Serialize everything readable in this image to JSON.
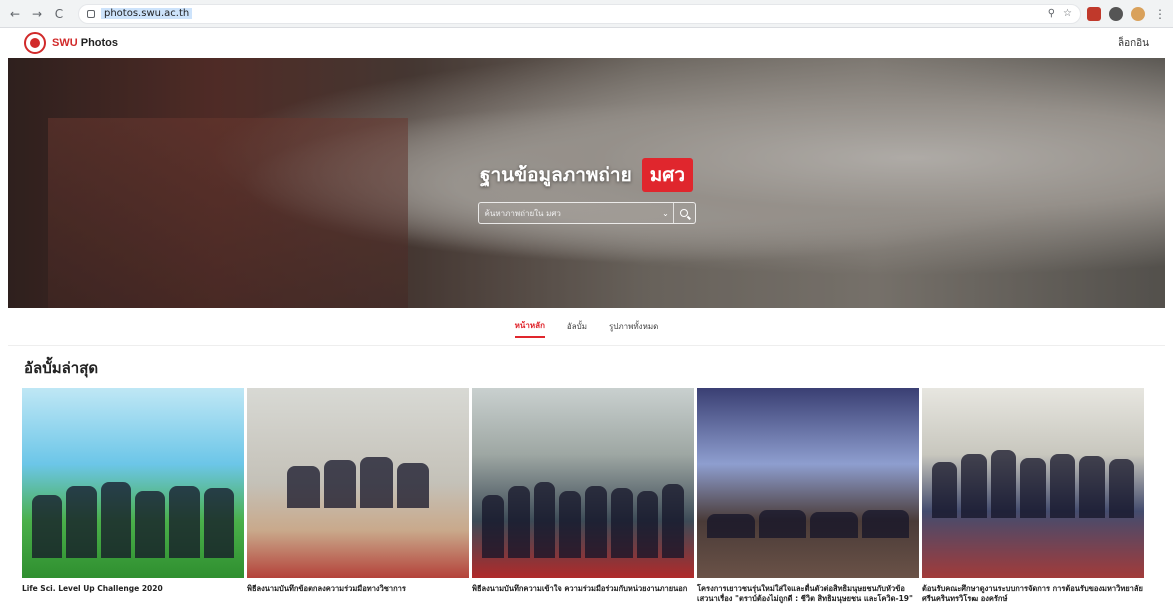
{
  "browser": {
    "url": "photos.swu.ac.th",
    "back_icon": "←",
    "forward_icon": "→",
    "reload_icon": "C"
  },
  "header": {
    "brand_prefix": "SWU",
    "brand_suffix": "Photos",
    "login_label": "ล็อกอิน"
  },
  "hero": {
    "title": "ฐานข้อมูลภาพถ่าย",
    "badge": "มศว",
    "search_placeholder": "ค้นหาภาพถ่ายใน มศว"
  },
  "tabs": [
    {
      "label": "หน้าหลัก"
    },
    {
      "label": "อัลบั้ม"
    },
    {
      "label": "รูปภาพทั้งหมด"
    }
  ],
  "latest": {
    "title": "อัลบั้มล่าสุด",
    "albums": [
      {
        "caption": "Life Sci. Level Up Challenge 2020"
      },
      {
        "caption": "พิธีลงนามบันทึกข้อตกลงความร่วมมือทางวิชาการ"
      },
      {
        "caption": "พิธีลงนามบันทึกความเข้าใจ ความร่วมมือร่วมกับหน่วยงานภายนอก"
      },
      {
        "caption": "โครงการเยาวชนรุ่นใหม่ใส่ใจและตื่นตัวต่อสิทธิมนุษยชนกับหัวข้อเสวนาเรื่อง \"ตราบ์ต้องไม่ถูกดี : ชีวิต สิทธิมนุษยชน และโควิด-19\""
      },
      {
        "caption": "ต้อนรับคณะศึกษาดูงานระบบการจัดการ การต้อนรับของมหาวิทยาลัยศรีนครินทรวิโรฒ องครักษ์"
      }
    ]
  }
}
